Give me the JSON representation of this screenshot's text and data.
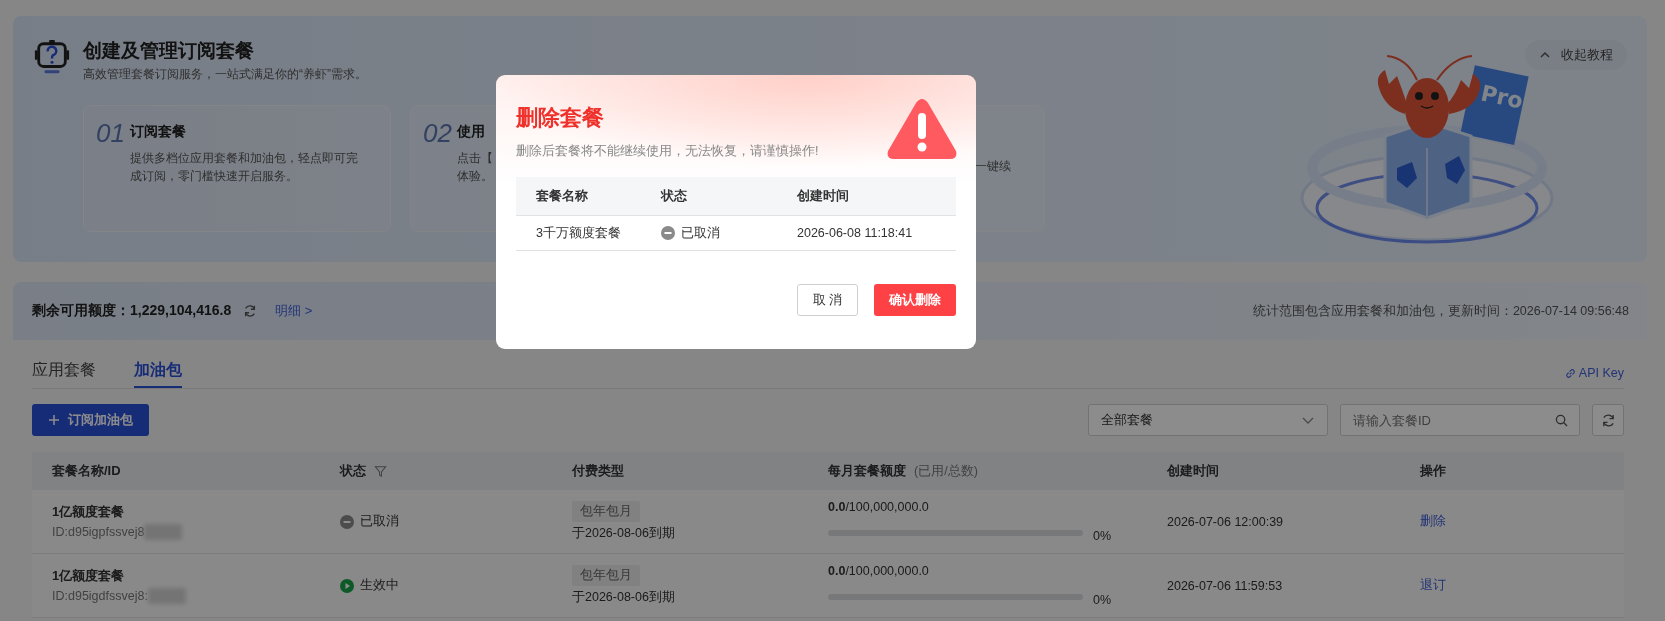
{
  "banner": {
    "title": "创建及管理订阅套餐",
    "subtitle": "高效管理套餐订阅服务，一站式满足你的“养虾”需求。",
    "collapse_button": "收起教程",
    "illustration_badge": "Pro",
    "steps": [
      {
        "number": "01",
        "title": "订阅套餐",
        "lines": [
          "提供多档位应用套餐和加油包，轻点即可完",
          "成订阅，零门槛快速开启服务。"
        ]
      },
      {
        "number": "02",
        "title": "使用",
        "lines": [
          "点击【",
          "体验。"
        ]
      },
      {
        "lines": [
          "一键续"
        ]
      }
    ]
  },
  "quota": {
    "label": "剩余可用额度：",
    "value": "1,229,104,416.8",
    "detail_link": "明细 >",
    "note": "统计范围包含应用套餐和加油包，更新时间：2026-07-14 09:56:48"
  },
  "tabs": [
    {
      "label": "应用套餐",
      "selected": false
    },
    {
      "label": "加油包",
      "selected": true
    }
  ],
  "api_key_link": "API Key",
  "toolbar": {
    "subscribe_button": "订阅加油包",
    "filter_select": "全部套餐",
    "search": {
      "placeholder": "请输入套餐ID"
    }
  },
  "table": {
    "columns": [
      {
        "label": "套餐名称/ID",
        "filter": false
      },
      {
        "label": "状态",
        "filter": true
      },
      {
        "label": "付费类型",
        "filter": false
      },
      {
        "label": "每月套餐额度",
        "note": "(已用/总数)",
        "filter": false
      },
      {
        "label": "创建时间",
        "filter": false
      },
      {
        "label": "操作",
        "filter": false
      }
    ],
    "rows": [
      {
        "name": "1亿额度套餐",
        "id": "ID:d95igpfssvej8",
        "kind": "cancelled",
        "status": "已取消",
        "billing_tag": "包年包月",
        "expiry": "于2026-08-06到期",
        "used": "0.0",
        "total": "/100,000,000.0",
        "level": 0,
        "percent": "0%",
        "created": "2026-07-06 12:00:39",
        "action": "删除"
      },
      {
        "name": "1亿额度套餐",
        "id": "ID:d95igdfssvej8:",
        "kind": "active",
        "status": "生效中",
        "billing_tag": "包年包月",
        "expiry": "于2026-08-06到期",
        "used": "0.0",
        "total": "/100,000,000.0",
        "level": 0,
        "percent": "0%",
        "created": "2026-07-06 11:59:53",
        "action": "退订"
      }
    ]
  },
  "modal": {
    "title": "删除套餐",
    "message": "删除后套餐将不能继续使用，无法恢复，请谨慎操作!",
    "columns": [
      "套餐名称",
      "状态",
      "创建时间"
    ],
    "rows": [
      {
        "name": "3千万额度套餐",
        "kind": "cancelled",
        "status": "已取消",
        "created": "2026-06-08 11:18:41"
      }
    ],
    "cancel_button": "取 消",
    "confirm_button": "确认删除"
  }
}
